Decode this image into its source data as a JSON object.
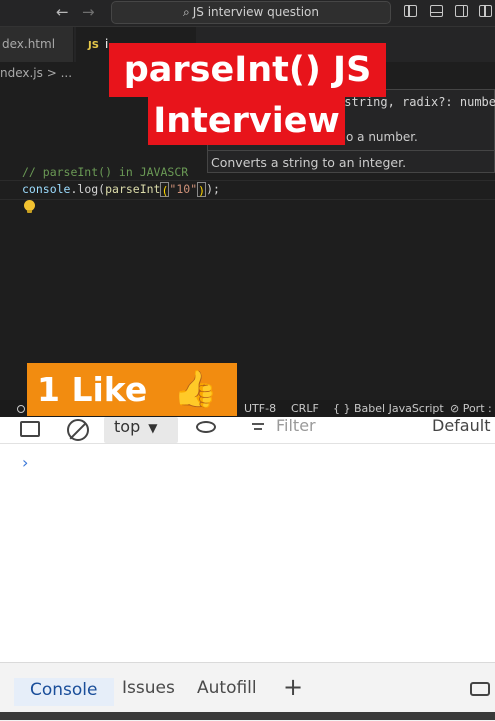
{
  "titlebar": {
    "search_text": "JS interview question",
    "back_icon": "←",
    "forward_icon": "→"
  },
  "tabs": {
    "html_tab": "dex.html",
    "js_badge": "JS",
    "js_tab": "i"
  },
  "breadcrumb": "ndex.js > ...",
  "editor": {
    "comment": "// parseInt() in JAVASCR",
    "code_obj": "console",
    "code_dot": ".log(",
    "code_fn": "parseInt",
    "code_open": "(",
    "code_str": "\"10\"",
    "code_close": ")",
    "code_end": ");"
  },
  "hover": {
    "signature_tail": "string, radix?: numbe",
    "signature_type": "tring",
    "desc1": "o a number.",
    "desc2": "Converts a string to an integer."
  },
  "overlay": {
    "title_line1": "parseInt() JS",
    "title_line2": "Interview",
    "like_text": "1 Like",
    "thumb": "👍"
  },
  "statusbar": {
    "encoding": "UTF-8",
    "eol": "CRLF",
    "language": "{ } Babel JavaScript",
    "port": "⊘ Port :"
  },
  "devtools": {
    "context": "top",
    "filter_placeholder": "Filter",
    "levels": "Default",
    "prompt": "›"
  },
  "drawer": {
    "tabs": [
      "Console",
      "Issues",
      "Autofill"
    ],
    "add": "+"
  },
  "colors": {
    "overlay_red": "#e8141b",
    "like_orange": "#f28c10",
    "editor_bg": "#1e1e1e"
  }
}
